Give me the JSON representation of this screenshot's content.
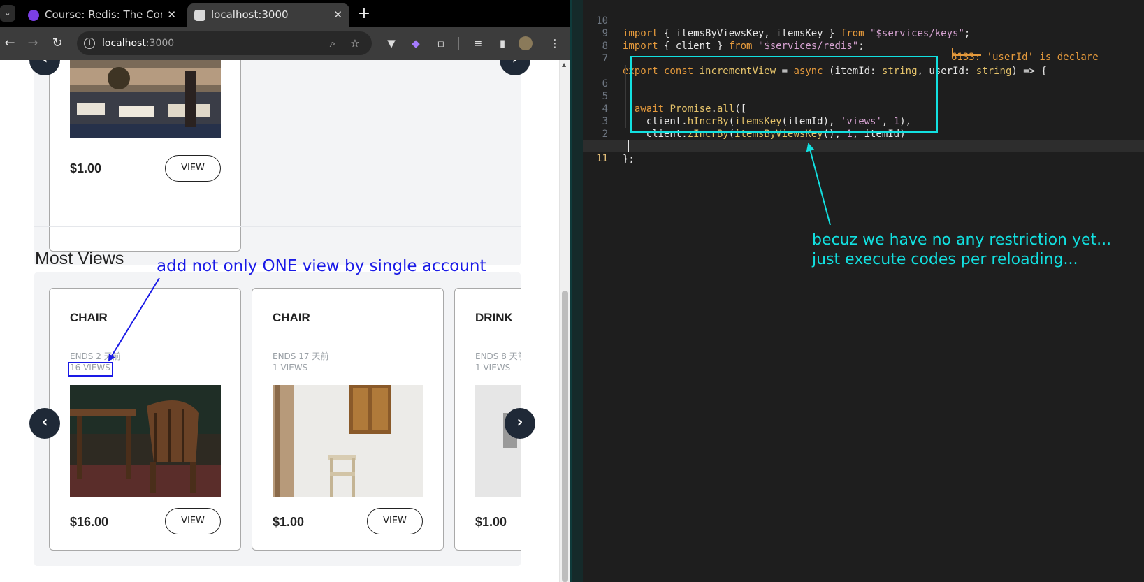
{
  "browser": {
    "tabs": [
      {
        "title": "Course: Redis: The Comp",
        "active": false
      },
      {
        "title": "localhost:3000",
        "active": true
      }
    ],
    "url_host": "localhost",
    "url_port": ":3000"
  },
  "page": {
    "top_card": {
      "price": "$1.00",
      "button": "VIEW"
    },
    "section_title": "Most Views",
    "cards": [
      {
        "title": "CHAIR",
        "ends": "ENDS 2 天前",
        "views": "16 VIEWS",
        "price": "$16.00",
        "button": "VIEW"
      },
      {
        "title": "CHAIR",
        "ends": "ENDS 17 天前",
        "views": "1 VIEWS",
        "price": "$1.00",
        "button": "VIEW"
      },
      {
        "title": "DRINK",
        "ends": "ENDS 8 天前",
        "views": "1 VIEWS",
        "price": "$1.00",
        "button": "VIEW"
      }
    ]
  },
  "editor": {
    "lines": [
      {
        "num": "10"
      },
      {
        "num": "9"
      },
      {
        "num": "8"
      },
      {
        "num": "7"
      },
      {
        "num": "6"
      },
      {
        "num": "5"
      },
      {
        "num": "4"
      },
      {
        "num": "3"
      },
      {
        "num": "2"
      },
      {
        "num": "1"
      },
      {
        "num": "11"
      }
    ],
    "diagnostic": "6133: 'userId' is declare"
  },
  "annotations": {
    "blue": "add not only ONE view by single account",
    "cyan_line1": "becuz we have no any restriction yet...",
    "cyan_line2": "just execute codes per reloading...",
    "blue_color": "#1a1ae6",
    "cyan_color": "#12e0e0"
  }
}
